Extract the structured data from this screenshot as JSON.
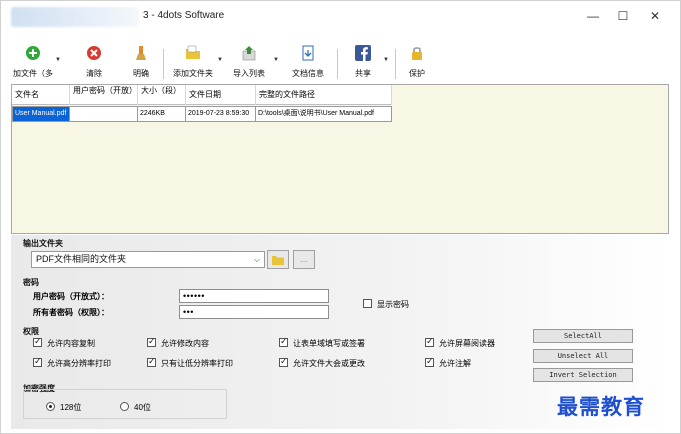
{
  "window": {
    "title": "3 - 4dots Software",
    "minimize_glyph": "—",
    "maximize_glyph": "☐",
    "close_glyph": "✕"
  },
  "toolbar": {
    "items": [
      {
        "label": "加文件（多",
        "icon": "add-icon",
        "color": "#2fa83a"
      },
      {
        "label": "清除",
        "icon": "clear-icon",
        "color": "#d93a2f"
      },
      {
        "label": "明确",
        "icon": "broom-icon",
        "color": "#e18a2c"
      },
      {
        "label": "添加文件夹",
        "icon": "add-folder-icon",
        "color": "#e9c43a"
      },
      {
        "label": "导入列表",
        "icon": "import-list-icon",
        "color": "#3a8e3a"
      },
      {
        "label": "文档信息",
        "icon": "document-info-icon",
        "color": "#2e6fb7"
      },
      {
        "label": "共享",
        "icon": "facebook-icon",
        "color": "#3b5998"
      },
      {
        "label": "保护",
        "icon": "lock-icon",
        "color": "#e2b72b"
      }
    ]
  },
  "grid": {
    "headers": [
      "文件名",
      "用户密码（开放）",
      "大小（段）",
      "文件日期",
      "完整的文件路径"
    ],
    "rows": [
      [
        "User Manual.pdf",
        "",
        "2246KB",
        "2019-07-23 8:59:30",
        "D:\\tools\\桌面\\说明书\\User Manual.pdf"
      ]
    ]
  },
  "output": {
    "title": "输出文件夹",
    "selected": "PDF文件相同的文件夹",
    "browse_label": "..."
  },
  "password": {
    "title": "密码",
    "user_label": "用户密码（开放式）：",
    "user_value": "••••••",
    "owner_label": "所有者密码（权限）：",
    "owner_value": "•••",
    "show_label": "显示密码"
  },
  "permissions": {
    "title": "权限",
    "items": [
      {
        "label": "允许内容复制",
        "checked": true
      },
      {
        "label": "允许修改内容",
        "checked": true
      },
      {
        "label": "让表单域填写或签署",
        "checked": true
      },
      {
        "label": "允许屏幕阅读器",
        "checked": true
      },
      {
        "label": "允许高分辨率打印",
        "checked": true
      },
      {
        "label": "只有让低分辨率打印",
        "checked": true
      },
      {
        "label": "允许文件大会或更改",
        "checked": true
      },
      {
        "label": "允许注解",
        "checked": true
      }
    ]
  },
  "side_buttons": {
    "select_all": "SelectAll",
    "unselect_all": "Unselect All",
    "invert": "Invert Selection"
  },
  "encryption": {
    "title": "加密强度",
    "opt128": "128位",
    "opt40": "40位",
    "selected": "128位"
  },
  "watermark": "最需教育"
}
